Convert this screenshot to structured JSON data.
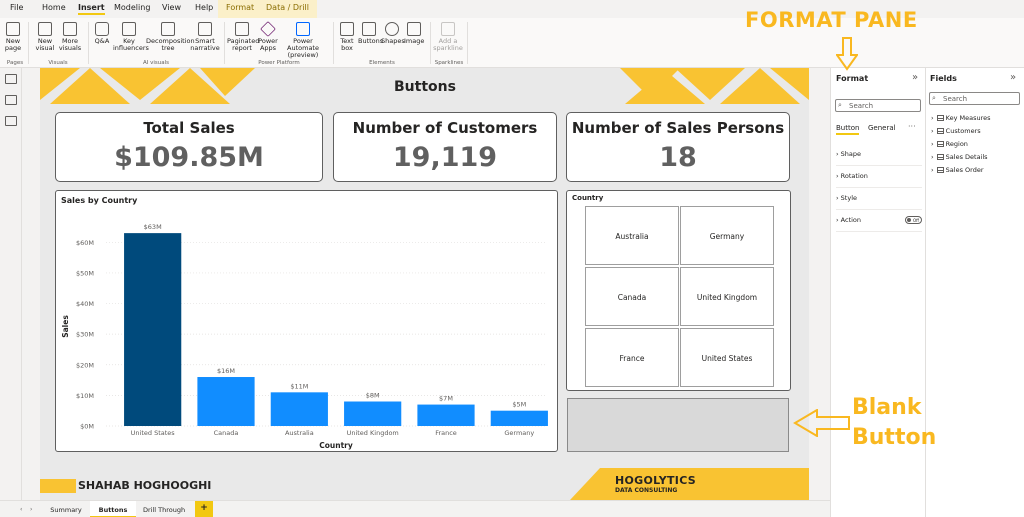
{
  "menu": {
    "items": [
      "File",
      "Home",
      "Insert",
      "Modeling",
      "View",
      "Help"
    ],
    "format_tab": "Format",
    "datadrill_tab": "Data / Drill"
  },
  "ribbon": {
    "buttons": {
      "new_page": "New page",
      "new_visual": "New visual",
      "more_visuals": "More visuals",
      "qa": "Q&A",
      "key_influencers": "Key influencers",
      "decomposition_tree": "Decomposition tree",
      "smart_narrative": "Smart narrative",
      "paginated_report": "Paginated report",
      "power_apps": "Power Apps",
      "power_automate": "Power Automate (preview)",
      "text_box": "Text box",
      "buttons": "Buttons",
      "shapes": "Shapes",
      "image": "Image",
      "add_sparkline": "Add a sparkline"
    },
    "groups": {
      "pages": "Pages",
      "visuals": "Visuals",
      "ai_visuals": "AI visuals",
      "power_platform": "Power Platform",
      "elements": "Elements",
      "sparklines": "Sparklines"
    }
  },
  "report": {
    "title": "Buttons",
    "kpis": [
      {
        "title": "Total Sales",
        "value": "$109.85M"
      },
      {
        "title": "Number of Customers",
        "value": "19,119"
      },
      {
        "title": "Number of Sales Persons",
        "value": "18"
      }
    ],
    "slicer": {
      "title": "Country",
      "options": [
        "Australia",
        "Germany",
        "Canada",
        "United Kingdom",
        "France",
        "United States"
      ]
    },
    "author": "SHAHAB HOGHOOGHI",
    "logo_main": "HOGOLYTICS",
    "logo_sub": "DATA CONSULTING"
  },
  "chart_data": {
    "type": "bar",
    "title": "Sales by Country",
    "xlabel": "Country",
    "ylabel": "Sales",
    "categories": [
      "United States",
      "Canada",
      "Australia",
      "United Kingdom",
      "France",
      "Germany"
    ],
    "values": [
      63,
      16,
      11,
      8,
      7,
      5
    ],
    "data_labels": [
      "$63M",
      "$16M",
      "$11M",
      "$8M",
      "$7M",
      "$5M"
    ],
    "yticks": [
      "$0M",
      "$10M",
      "$20M",
      "$30M",
      "$40M",
      "$50M",
      "$60M"
    ],
    "ylim": [
      0,
      65
    ],
    "colors": {
      "highlight": "#004a7c",
      "normal": "#118dff"
    }
  },
  "format_pane": {
    "title": "Format",
    "search_placeholder": "Search",
    "tab_button": "Button",
    "tab_general": "General",
    "more": "···",
    "sections": [
      "Shape",
      "Rotation",
      "Style",
      "Action"
    ],
    "action_toggle": "Off"
  },
  "fields_pane": {
    "title": "Fields",
    "search_placeholder": "Search",
    "tables": [
      "Key Measures",
      "Customers",
      "Region",
      "Sales Details",
      "Sales Order"
    ]
  },
  "page_tabs": [
    "Summary",
    "Buttons",
    "Drill Through"
  ],
  "page_tabs_add": "+",
  "annotations": {
    "format_pane_label": "FORMAT PANE",
    "blank_button_line1": "Blank",
    "blank_button_line2": "Button"
  },
  "colors": {
    "accent_yellow": "#f9c332",
    "selected_bar": "#004a7c",
    "bar": "#118dff"
  }
}
